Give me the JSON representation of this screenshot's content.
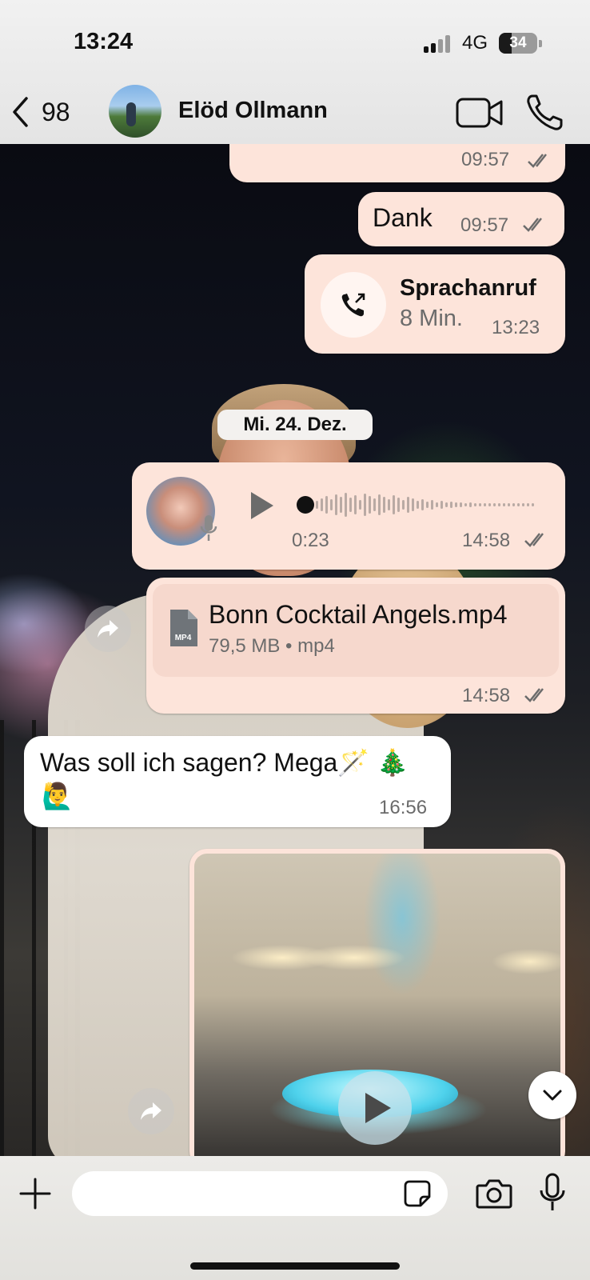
{
  "status_bar": {
    "time": "13:24",
    "network": "4G",
    "battery": "34",
    "battery_level": 0.34
  },
  "header": {
    "back_count": "98",
    "contact_name": "Elöd Ollmann"
  },
  "messages": {
    "m1": {
      "time": "09:57"
    },
    "m2": {
      "text": "Dank",
      "time": "09:57"
    },
    "call": {
      "title": "Sprachanruf",
      "duration": "8 Min.",
      "time": "13:23"
    },
    "date_separator": "Mi. 24. Dez.",
    "voice": {
      "duration": "0:23",
      "time": "14:58",
      "progress": 0.0
    },
    "file": {
      "name": "Bonn Cocktail Angels.mp4",
      "meta": "79,5 MB • mp4",
      "icon_label": "MP4",
      "time": "14:58"
    },
    "incoming": {
      "text": "Was soll ich sagen? Mega🪄 🎄",
      "emoji_line": "🙋‍♂️",
      "time": "16:56"
    }
  },
  "composer": {
    "placeholder": ""
  },
  "colors": {
    "outgoing_bubble": "#fde4da",
    "incoming_bubble": "#ffffff",
    "header_bg": "#eeeeee"
  },
  "icons": [
    "chevron-left-icon",
    "video-camera-icon",
    "phone-icon",
    "outgoing-call-icon",
    "play-icon",
    "microphone-icon",
    "file-icon",
    "forward-icon",
    "chevron-down-icon",
    "plus-icon",
    "sticker-icon",
    "camera-icon",
    "double-check-icon"
  ]
}
